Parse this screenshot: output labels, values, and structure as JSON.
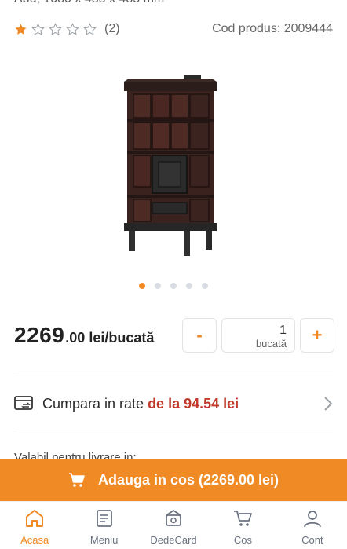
{
  "header": {
    "title_fragment": "Abu, 1080 x 485 x 485 mm"
  },
  "rating": {
    "value": 1,
    "max": 5,
    "count_text": "(2)"
  },
  "product": {
    "code_text": "Cod produs: 2009444",
    "image_icon": "tile-stove-image"
  },
  "carousel": {
    "total": 5,
    "active_index": 0
  },
  "price": {
    "integer": "2269",
    "suffix": ".00 lei/bucată"
  },
  "quantity": {
    "minus": "-",
    "value": "1",
    "unit": "bucată",
    "plus": "+"
  },
  "installments": {
    "label": "Cumpara in rate",
    "price_text": "de la 94.54 lei",
    "icon": "card-installments-icon"
  },
  "delivery_fragment": "Valabil pentru livrare in:",
  "cart": {
    "label": "Adauga in cos (2269.00 lei)"
  },
  "nav": {
    "items": [
      {
        "label": "Acasa",
        "icon": "home-icon"
      },
      {
        "label": "Meniu",
        "icon": "menu-document-icon"
      },
      {
        "label": "DedeCard",
        "icon": "card-tag-icon"
      },
      {
        "label": "Cos",
        "icon": "cart-icon"
      },
      {
        "label": "Cont",
        "icon": "user-icon"
      }
    ],
    "active_index": 0
  },
  "colors": {
    "accent": "#f08a24",
    "price_red": "#c0392b"
  }
}
